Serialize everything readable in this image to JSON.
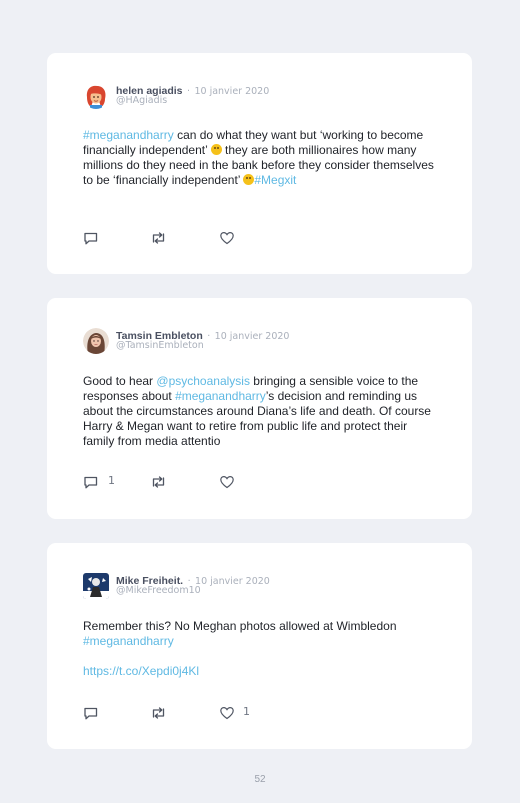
{
  "tweets": [
    {
      "author": "helen agiadis",
      "separator": "·",
      "date": "10 janvier 2020",
      "handle": "@HAgiadis",
      "text": {
        "t1": "#meganandharry",
        "t2": " can do what they want but ‘working to become financially independent’ ",
        "t3": " they are both millionaires how many millions do they need in the bank before they consider themselves to be ‘financially independent’ ",
        "t4": "#Megxit"
      },
      "avatar_icon": "woman-red-hair-emoji-avatar",
      "emoji_icon": "thinking-face-emoji"
    },
    {
      "author": "Tamsin Embleton",
      "separator": "·",
      "date": "10 janvier 2020",
      "handle": "@TamsinEmbleton",
      "text": {
        "t1": "Good to hear ",
        "t2": "@psychoanalysis",
        "t3": " bringing a sensible voice to the responses about ",
        "t4": "#meganandharry",
        "t5": "’s decision and reminding us about the circumstances around Diana’s life and death. Of course Harry & Megan want to retire from public life and protect their family from media attentio"
      },
      "reply_count": "1"
    },
    {
      "author": "Mike Freiheit.",
      "separator": "·",
      "date": "10 janvier 2020",
      "handle": "@MikeFreedom10",
      "text": {
        "t1": "Remember this? No Meghan photos allowed at Wimbledon ",
        "t2": "#meganandharry",
        "link": "https://t.co/Xepdi0j4Kl"
      },
      "like_count": "1"
    }
  ],
  "page_number": "52",
  "colors": {
    "background": "#eef0f5",
    "card": "#ffffff",
    "link": "#5fb9e3",
    "muted": "#aab0bb",
    "icon": "#4f5562"
  }
}
